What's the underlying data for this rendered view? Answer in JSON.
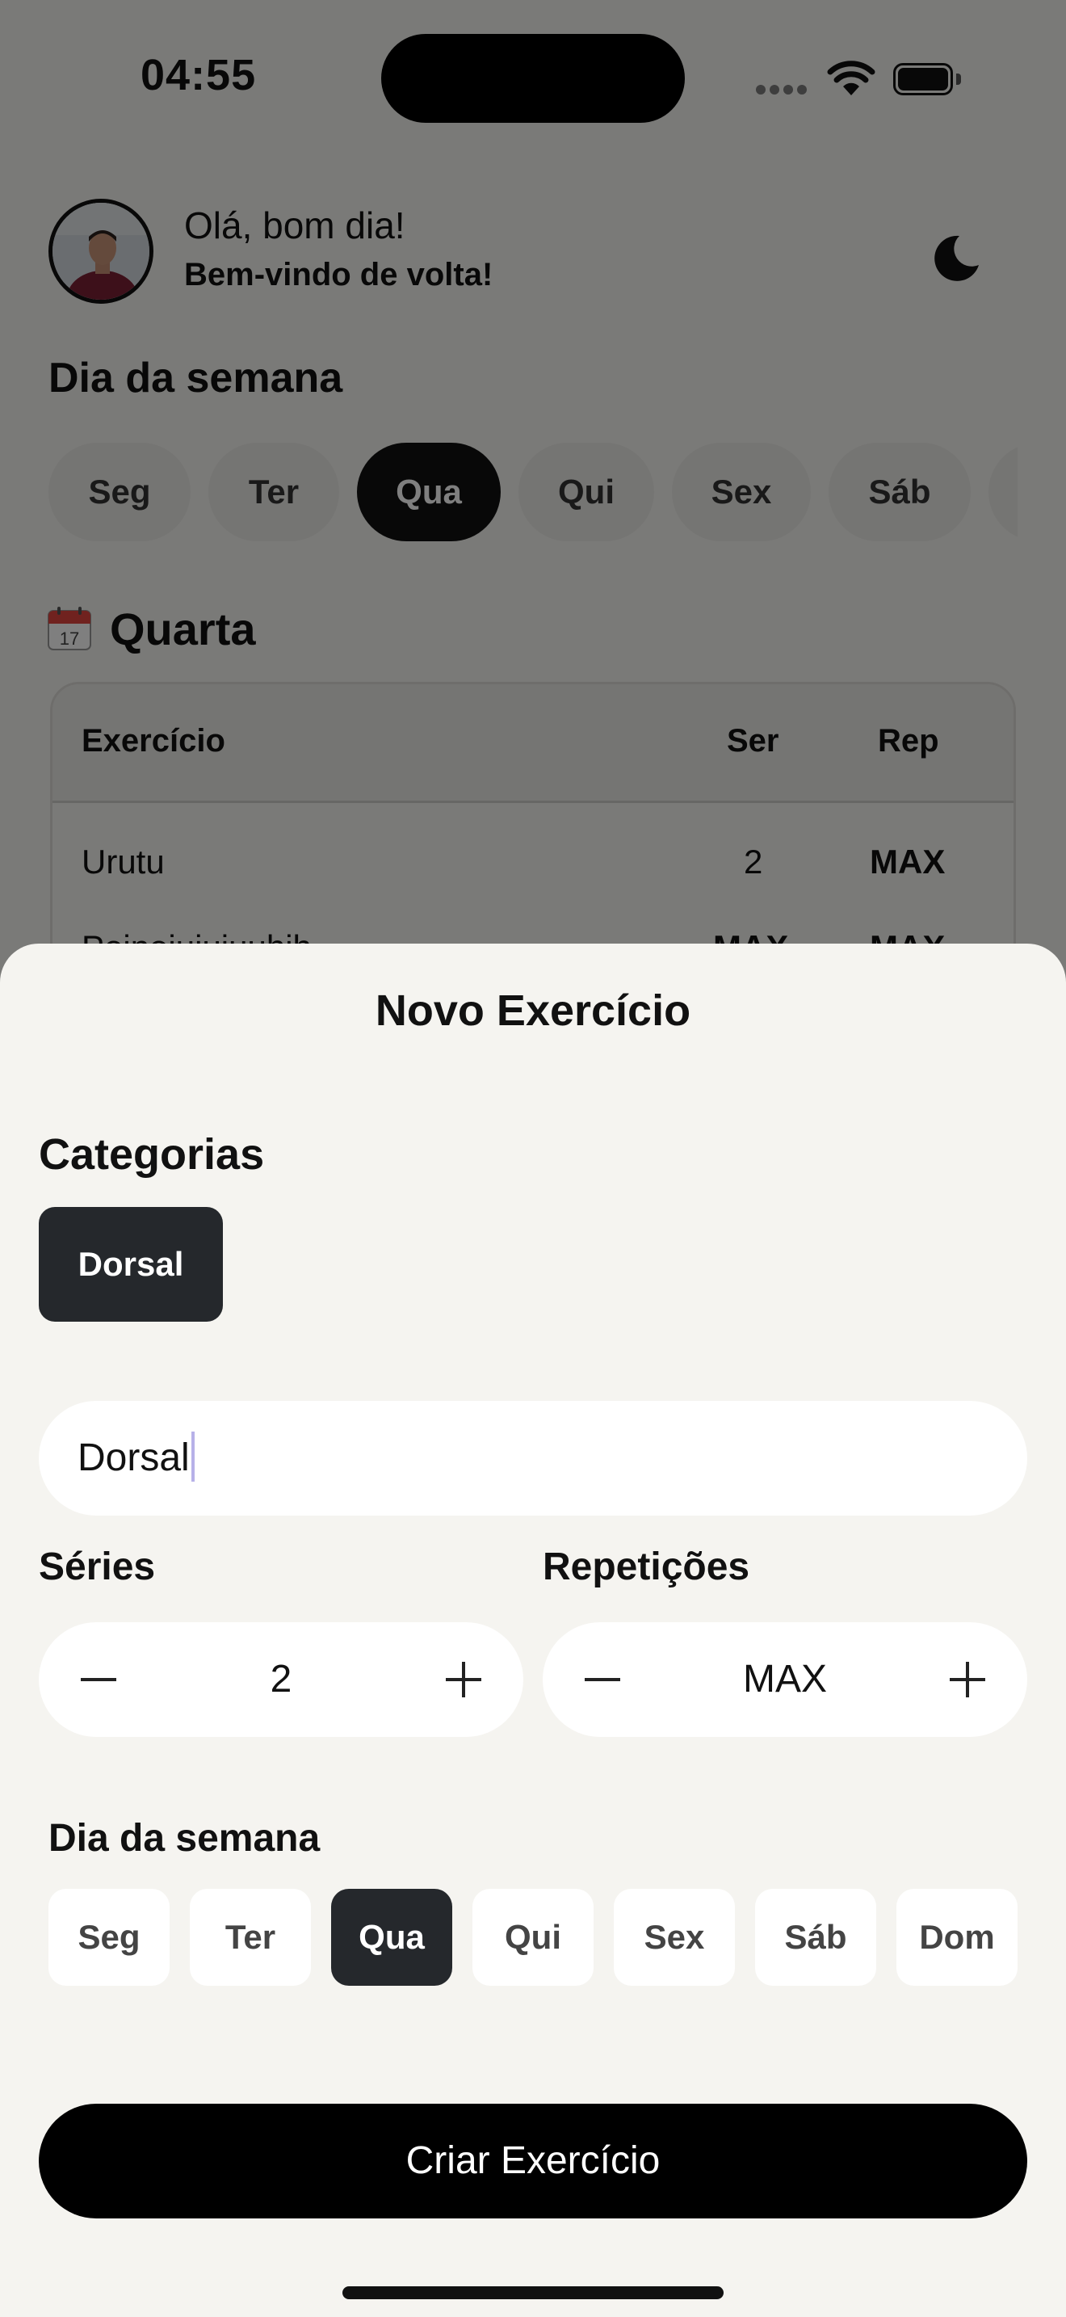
{
  "status_bar": {
    "time": "04:55"
  },
  "header": {
    "greeting": "Olá, bom dia!",
    "welcome": "Bem-vindo de volta!"
  },
  "weekday_section": {
    "title": "Dia da semana",
    "days": [
      "Seg",
      "Ter",
      "Qua",
      "Qui",
      "Sex",
      "Sáb"
    ],
    "selected": "Qua"
  },
  "schedule": {
    "title": "Quarta",
    "columns": {
      "exercise": "Exercício",
      "sets": "Ser",
      "reps": "Rep"
    },
    "rows": [
      {
        "exercise": "Urutu",
        "sets": "2",
        "reps": "MAX"
      },
      {
        "exercise": "Poinoiuiuiuuhih",
        "sets": "MAX",
        "reps": "MAX"
      }
    ]
  },
  "sheet": {
    "title": "Novo Exercício",
    "categories_label": "Categorias",
    "categories": [
      "Dorsal"
    ],
    "name_value": "Dorsal",
    "series_label": "Séries",
    "series_value": "2",
    "reps_label": "Repetições",
    "reps_value": "MAX",
    "weekday_label": "Dia da semana",
    "days": [
      "Seg",
      "Ter",
      "Qua",
      "Qui",
      "Sex",
      "Sáb",
      "Dom"
    ],
    "selected_day": "Qua",
    "submit_label": "Criar Exercício"
  },
  "colors": {
    "dark_chip": "#25282c",
    "sheet_bg": "#f5f4f0",
    "overlay": "rgba(0,0,0,0.5)"
  }
}
